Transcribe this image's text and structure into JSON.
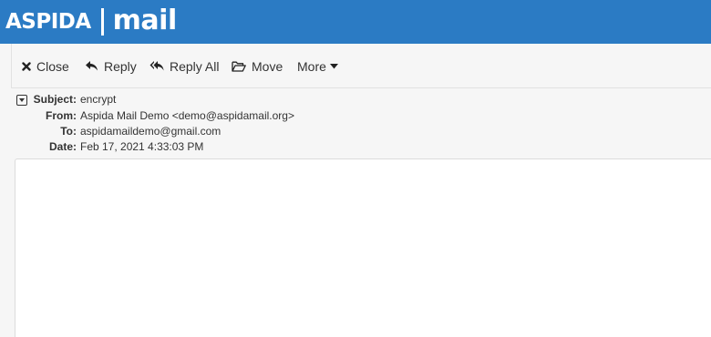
{
  "header": {
    "brand": "ASPIDA",
    "product": "mail",
    "background_color": "#2b7bc4"
  },
  "toolbar": {
    "close": {
      "label": "Close",
      "icon": "close-icon"
    },
    "reply": {
      "label": "Reply",
      "icon": "reply-icon"
    },
    "reply_all": {
      "label": "Reply All",
      "icon": "reply-all-icon"
    },
    "move": {
      "label": "Move",
      "icon": "folder-open-icon"
    },
    "more": {
      "label": "More",
      "icon": "caret-down-icon"
    }
  },
  "message": {
    "subject_label": "Subject:",
    "subject": "encrypt",
    "from_label": "From:",
    "from": "Aspida Mail Demo <demo@aspidamail.org>",
    "to_label": "To:",
    "to": "aspidamaildemo@gmail.com",
    "date_label": "Date:",
    "date": "Feb 17, 2021 4:33:03 PM",
    "body": ""
  }
}
